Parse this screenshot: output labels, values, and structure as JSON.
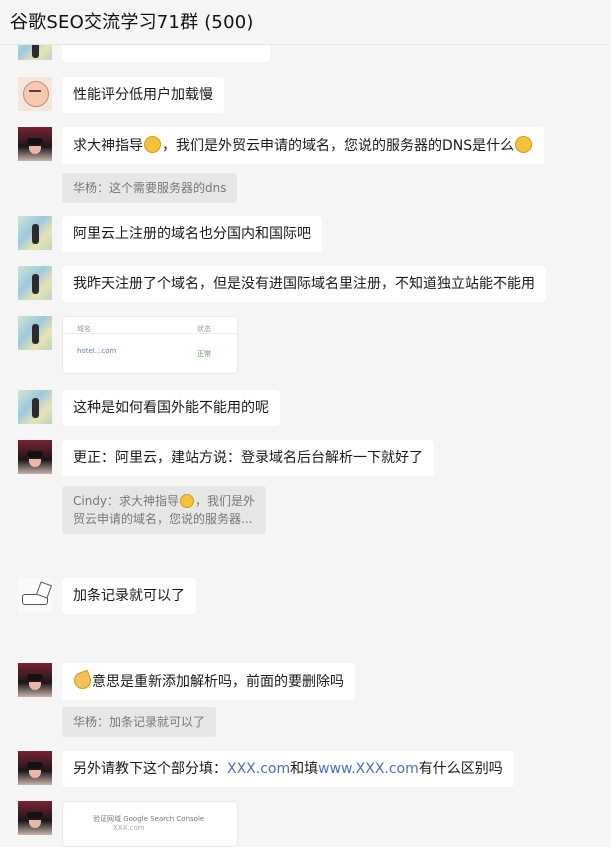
{
  "window": {
    "title": "谷歌SEO交流学习71群 (500)"
  },
  "colors": {
    "link": "#4a6ec7",
    "quote_bg": "#e7e7e7",
    "bubble_bg": "#ffffff",
    "page_bg": "#f5f5f5"
  },
  "messages": [
    {
      "avatar": "baby-cartoon-avatar",
      "text": "性能评分低用户加载慢"
    },
    {
      "avatar": "girl-sunglasses-avatar",
      "text_a": "求大神指导",
      "text_b": "，我们是外贸云申请的域名，您说的服务器的DNS是什么",
      "quote": "华杨：这个需要服务器的dns"
    },
    {
      "avatar": "map-person-avatar",
      "text": "阿里云上注册的域名也分国内和国际吧"
    },
    {
      "avatar": "map-person-avatar",
      "text": "我昨天注册了个域名，但是没有进国际域名里注册，不知道独立站能不能用"
    },
    {
      "avatar": "map-person-avatar",
      "image_cells": [
        "域名",
        "状态",
        "hotel...com",
        "正常"
      ]
    },
    {
      "avatar": "map-person-avatar",
      "text": "这种是如何看国外能不能用的呢"
    },
    {
      "avatar": "girl-sunglasses-avatar",
      "text": "更正：阿里云，建站方说：登录域名后台解析一下就好了",
      "quote_a": "Cindy：求大神指导",
      "quote_b": "，我们是外",
      "quote_c": "贸云申请的域名，您说的服务器..."
    },
    {
      "avatar": "sketch-avatar",
      "text": "加条记录就可以了"
    },
    {
      "avatar": "girl-sunglasses-avatar",
      "text": "意思是重新添加解析吗，前面的要删除吗",
      "quote": "华杨：加条记录就可以了"
    },
    {
      "avatar": "girl-sunglasses-avatar",
      "text_a": "另外请教下这个部分填：",
      "link_a": "XXX.com",
      "text_b": "和填",
      "link_b": "www.XXX.com",
      "text_c": "有什么区别吗"
    },
    {
      "avatar": "girl-sunglasses-avatar",
      "image_cells": [
        "验证网域 Google Search Console",
        "XXX.com"
      ]
    }
  ]
}
